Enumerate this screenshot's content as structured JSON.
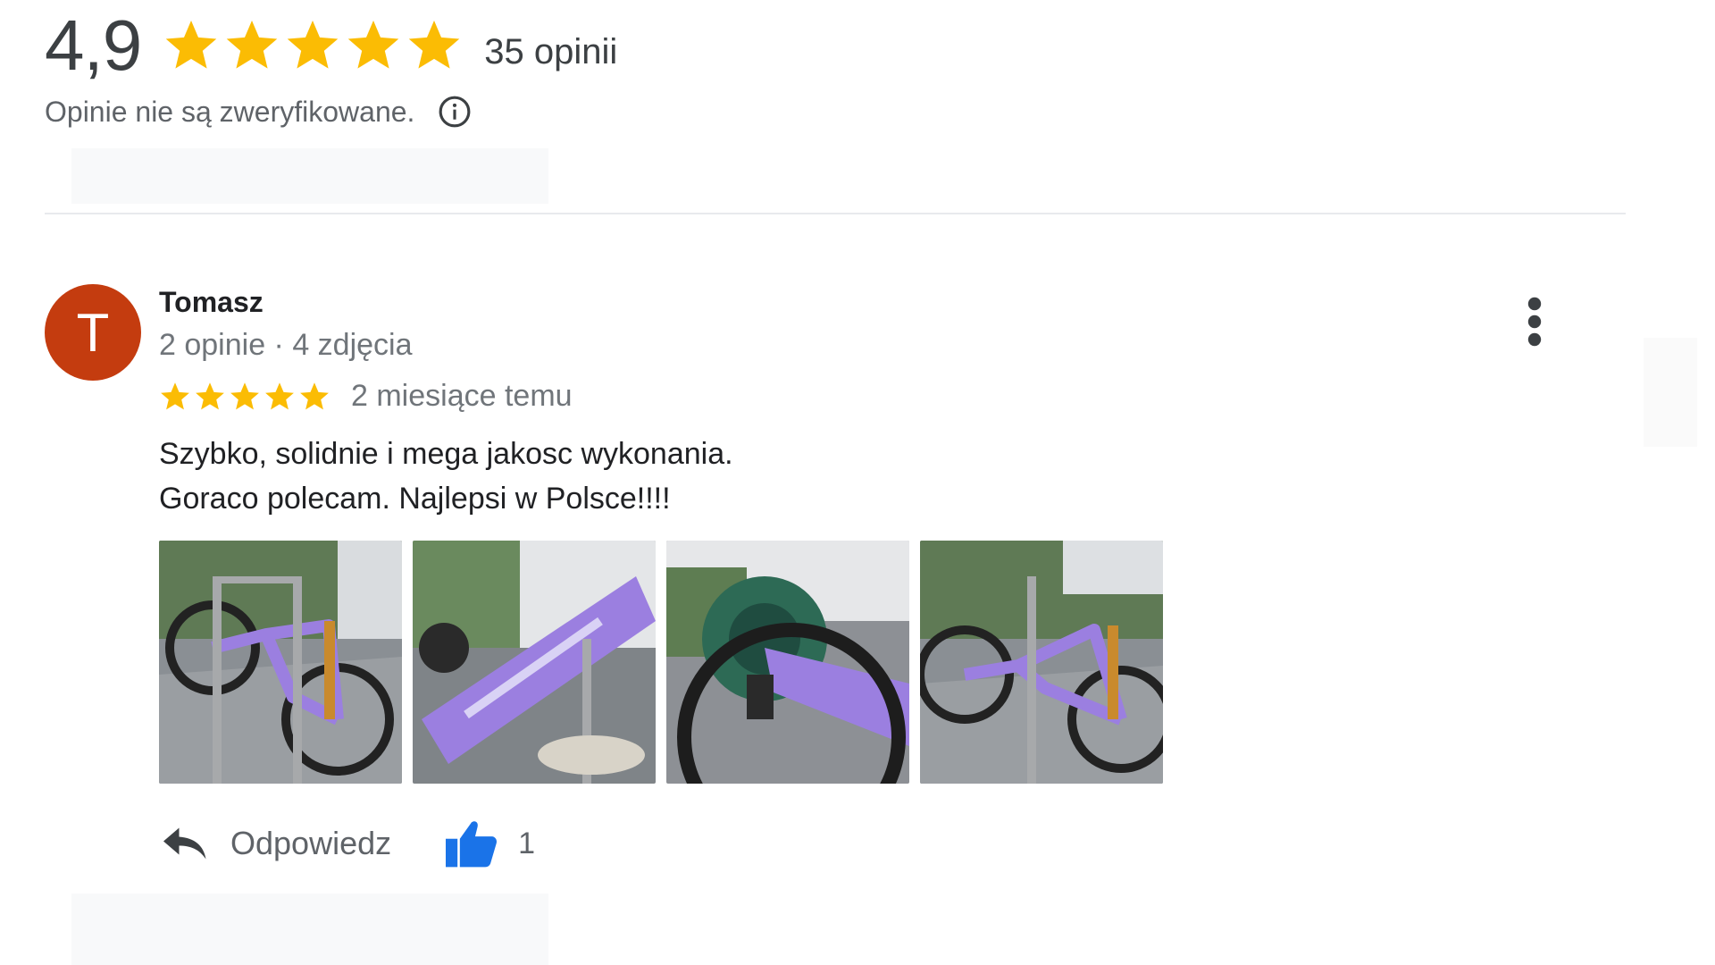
{
  "summary": {
    "rating": "4,9",
    "stars": 5,
    "count_label": "35 opinii",
    "verify_text": "Opinie nie są zweryfikowane.",
    "info_icon": "info-icon"
  },
  "review": {
    "avatar_letter": "T",
    "author": "Tomasz",
    "meta": "2 opinie · 4 zdjęcia",
    "stars": 5,
    "time": "2 miesiące temu",
    "text_lines": [
      "Szybko, solidnie i mega jakosc wykonania.",
      "Goraco polecam. Najlepsi w Polsce!!!!"
    ],
    "photos": [
      "bike-photo-1",
      "bike-photo-2",
      "bike-photo-3",
      "bike-photo-4"
    ],
    "reply_label": "Odpowiedz",
    "like_count": "1"
  },
  "colors": {
    "star": "#fbbc04",
    "avatar_bg": "#c43c0f",
    "like_blue": "#1a73e8",
    "bike_purple": "#9b7fe0"
  }
}
